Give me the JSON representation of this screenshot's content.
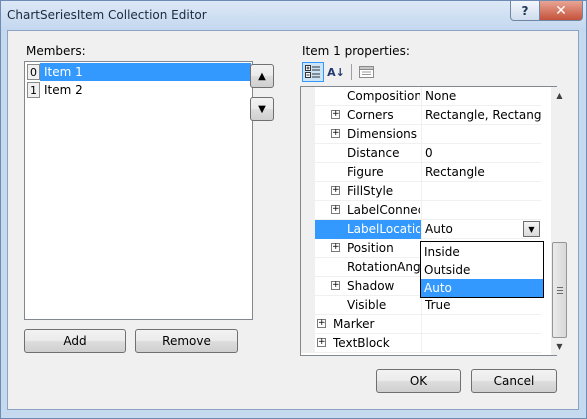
{
  "window": {
    "title": "ChartSeriesItem Collection Editor",
    "help_label": "?",
    "close_label": "✕"
  },
  "members": {
    "label": "Members:",
    "items": [
      {
        "index": "0",
        "text": "Item 1",
        "selected": true
      },
      {
        "index": "1",
        "text": "Item 2",
        "selected": false
      }
    ],
    "up_label": "▲",
    "down_label": "▼",
    "add_label": "Add",
    "remove_label": "Remove"
  },
  "properties": {
    "label": "Item 1 properties:",
    "toolbar": {
      "categorized_icon": "categorized-icon",
      "alphabetical_label": "A↓",
      "property_pages_icon": "property-pages-icon"
    },
    "rows": [
      {
        "name": "CompositionT",
        "value": "None",
        "expandable": false,
        "indent": 2
      },
      {
        "name": "Corners",
        "value": "Rectangle, Rectangle, R",
        "expandable": true,
        "indent": 2
      },
      {
        "name": "Dimensions",
        "value": "",
        "expandable": true,
        "indent": 2
      },
      {
        "name": "Distance",
        "value": "0",
        "expandable": false,
        "indent": 2
      },
      {
        "name": "Figure",
        "value": "Rectangle",
        "expandable": false,
        "indent": 2
      },
      {
        "name": "FillStyle",
        "value": "",
        "expandable": true,
        "indent": 2
      },
      {
        "name": "LabelConnect",
        "value": "",
        "expandable": true,
        "indent": 2
      },
      {
        "name": "LabelLocation",
        "value": "Auto",
        "expandable": false,
        "indent": 2,
        "selected": true
      },
      {
        "name": "Position",
        "value": "",
        "expandable": true,
        "indent": 2
      },
      {
        "name": "RotationAngle",
        "value": "",
        "expandable": false,
        "indent": 2
      },
      {
        "name": "Shadow",
        "value": "",
        "expandable": true,
        "indent": 2
      },
      {
        "name": "Visible",
        "value": "True",
        "expandable": false,
        "indent": 2
      },
      {
        "name": "Marker",
        "value": "",
        "expandable": true,
        "indent": 1
      },
      {
        "name": "TextBlock",
        "value": "",
        "expandable": true,
        "indent": 1
      }
    ],
    "dropdown_options": [
      {
        "text": "Inside",
        "selected": false
      },
      {
        "text": "Outside",
        "selected": false
      },
      {
        "text": "Auto",
        "selected": true
      }
    ]
  },
  "footer": {
    "ok_label": "OK",
    "cancel_label": "Cancel"
  }
}
